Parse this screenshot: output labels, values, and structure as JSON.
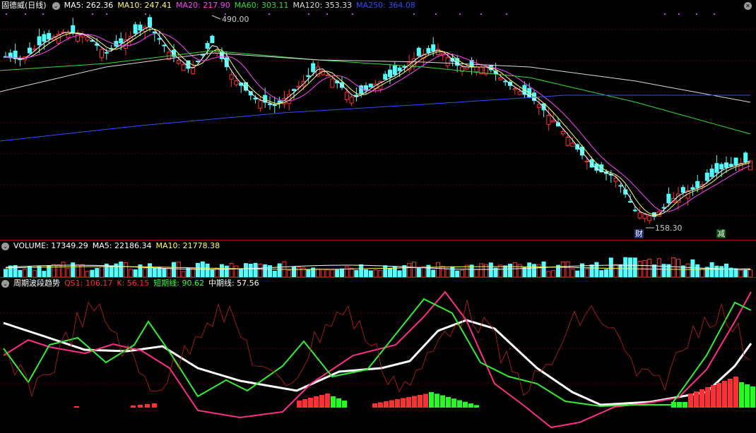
{
  "main": {
    "title": "固德威(日线)",
    "indicators": [
      {
        "label": "MA5: 262.36",
        "color": "#ffffff"
      },
      {
        "label": "MA10: 247.41",
        "color": "#ffff66"
      },
      {
        "label": "MA20: 217.90",
        "color": "#ff44ff"
      },
      {
        "label": "MA60: 303.11",
        "color": "#33dd33"
      },
      {
        "label": "MA120: 353.33",
        "color": "#dddddd"
      },
      {
        "label": "MA250: 364.08",
        "color": "#2f4fff"
      }
    ],
    "high_label": "490.00",
    "low_label": "158.30",
    "tag_left": "财",
    "tag_right": "减"
  },
  "volume": {
    "title": "VOLUME: 17349.29",
    "ma5": "MA5: 22186.34",
    "ma10": "MA10: 21778.38"
  },
  "oscillator": {
    "title": "周期波段趋势",
    "qs1": "QS1: 106.17",
    "k": "K: 56.15",
    "short": "短期线: 90.62",
    "mid": "中期线: 57.56"
  },
  "colors": {
    "up": "#ff3030",
    "down": "#54ffff",
    "separator": "#b00000",
    "grid": "#7a0000"
  }
}
